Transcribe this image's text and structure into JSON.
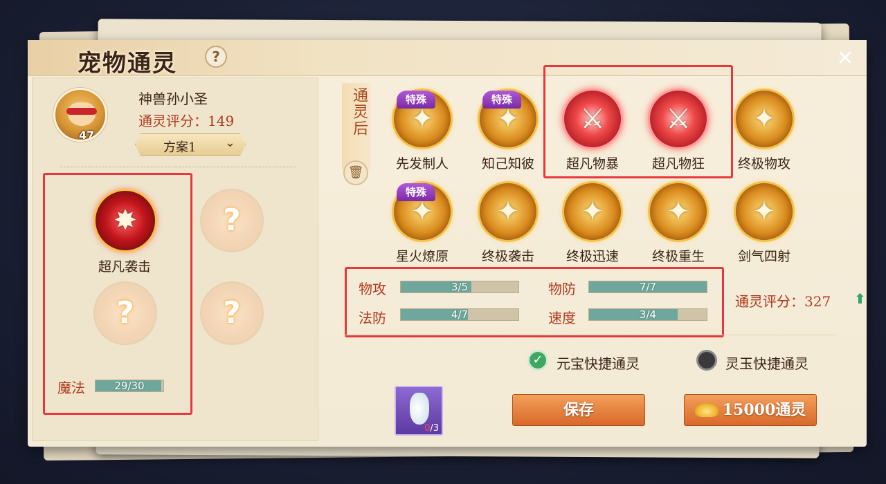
{
  "title": "宠物通灵",
  "help_glyph": "?",
  "close_glyph": "✕",
  "pet": {
    "name": "神兽孙小圣",
    "score_label": "通灵评分：149",
    "level": "47",
    "plan_label": "方案1"
  },
  "left_skills": [
    {
      "label": "超凡袭击",
      "icon": "red-claw-strike-icon",
      "empty": false
    },
    {
      "label": "",
      "icon": "question-icon",
      "empty": true
    },
    {
      "label": "",
      "icon": "question-icon",
      "empty": true
    },
    {
      "label": "",
      "icon": "question-icon",
      "empty": true
    }
  ],
  "question_glyph": "?",
  "magic": {
    "label": "魔法",
    "value_text": "29/30",
    "fraction": 0.967
  },
  "after_tab": "通灵后",
  "special_tag": "特殊",
  "skills_grid": [
    {
      "label": "先发制人",
      "special": true,
      "style": "gold"
    },
    {
      "label": "知己知彼",
      "special": true,
      "style": "gold"
    },
    {
      "label": "超凡物暴",
      "special": false,
      "style": "crimson"
    },
    {
      "label": "超凡物狂",
      "special": false,
      "style": "crimson"
    },
    {
      "label": "终极物攻",
      "special": false,
      "style": "gold"
    },
    {
      "label": "星火燎原",
      "special": true,
      "style": "gold"
    },
    {
      "label": "终极袭击",
      "special": false,
      "style": "gold"
    },
    {
      "label": "终极迅速",
      "special": false,
      "style": "gold"
    },
    {
      "label": "终极重生",
      "special": false,
      "style": "gold"
    },
    {
      "label": "剑气四射",
      "special": false,
      "style": "gold"
    }
  ],
  "stats": [
    {
      "label": "物攻",
      "value_text": "3/5",
      "fraction": 0.6
    },
    {
      "label": "物防",
      "value_text": "7/7",
      "fraction": 1.0
    },
    {
      "label": "法防",
      "value_text": "4/7",
      "fraction": 0.571
    },
    {
      "label": "速度",
      "value_text": "3/4",
      "fraction": 0.75
    }
  ],
  "score_after": {
    "label": "通灵评分：327",
    "arrow": "⬆"
  },
  "options": {
    "yuanbao": {
      "label": "元宝快捷通灵",
      "checked": true
    },
    "lingyu": {
      "label": "灵玉快捷通灵",
      "checked": false
    }
  },
  "item": {
    "count_have": "0",
    "count_total": "/3"
  },
  "buttons": {
    "save": "保存",
    "cost": "15000通灵"
  },
  "colors": {
    "accent_red": "#b03a1e",
    "bar_fill": "#6fa79c",
    "highlight_box": "#e8383d"
  }
}
